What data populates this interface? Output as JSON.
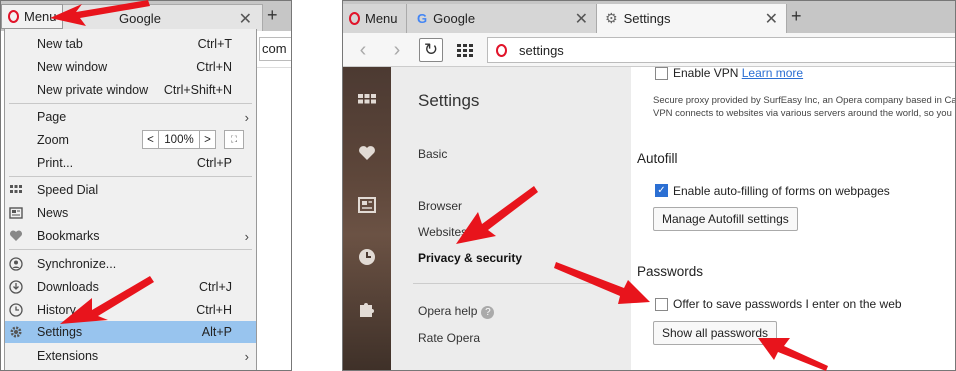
{
  "left": {
    "menu_button": "Menu",
    "tab_title": "Google",
    "address_fragment": "com",
    "items": [
      {
        "label": "New tab",
        "shortcut": "Ctrl+T"
      },
      {
        "label": "New window",
        "shortcut": "Ctrl+N"
      },
      {
        "label": "New private window",
        "shortcut": "Ctrl+Shift+N"
      },
      {
        "label": "Page",
        "shortcut": ""
      },
      {
        "label": "Zoom",
        "shortcut": ""
      },
      {
        "label": "Print...",
        "shortcut": "Ctrl+P"
      },
      {
        "label": "Speed Dial",
        "shortcut": ""
      },
      {
        "label": "News",
        "shortcut": ""
      },
      {
        "label": "Bookmarks",
        "shortcut": ""
      },
      {
        "label": "Synchronize...",
        "shortcut": ""
      },
      {
        "label": "Downloads",
        "shortcut": "Ctrl+J"
      },
      {
        "label": "History",
        "shortcut": "Ctrl+H"
      },
      {
        "label": "Settings",
        "shortcut": "Alt+P"
      },
      {
        "label": "Extensions",
        "shortcut": ""
      }
    ],
    "zoom_value": "100%",
    "zoom_minus": "<",
    "zoom_plus": ">"
  },
  "right": {
    "tabs": [
      {
        "label": "Menu"
      },
      {
        "label": "Google"
      },
      {
        "label": "Settings"
      }
    ],
    "address": "settings",
    "nav": {
      "title": "Settings",
      "basic": "Basic",
      "browser": "Browser",
      "websites": "Websites",
      "privacy": "Privacy & security",
      "help": "Opera help",
      "rate": "Rate Opera"
    },
    "content": {
      "vpn_label": "Enable VPN",
      "vpn_link": "Learn more",
      "vpn_desc_1": "Secure proxy provided by SurfEasy Inc, an Opera company based in Ca",
      "vpn_desc_2": "VPN connects to websites via various servers around the world, so you",
      "autofill_title": "Autofill",
      "autofill_check": "Enable auto-filling of forms on webpages",
      "autofill_button": "Manage Autofill settings",
      "passwords_title": "Passwords",
      "passwords_check": "Offer to save passwords I enter on the web",
      "passwords_button": "Show all passwords"
    }
  },
  "colors": {
    "opera_red": "#e1142a",
    "arrow_red": "#e8141c",
    "highlight": "#98c4ee",
    "checkbox_blue": "#2b6fd3"
  }
}
